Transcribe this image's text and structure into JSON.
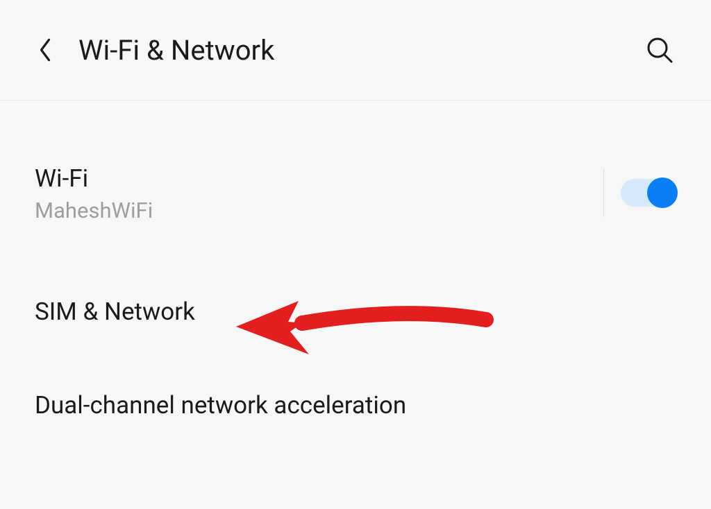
{
  "header": {
    "title": "Wi-Fi & Network"
  },
  "settings": {
    "wifi": {
      "title": "Wi-Fi",
      "subtitle": "MaheshWiFi",
      "toggle_on": true
    },
    "sim_network": {
      "title": "SIM & Network"
    },
    "dual_channel": {
      "title": "Dual-channel network acceleration"
    }
  },
  "annotation": {
    "color": "#e31e1e"
  }
}
